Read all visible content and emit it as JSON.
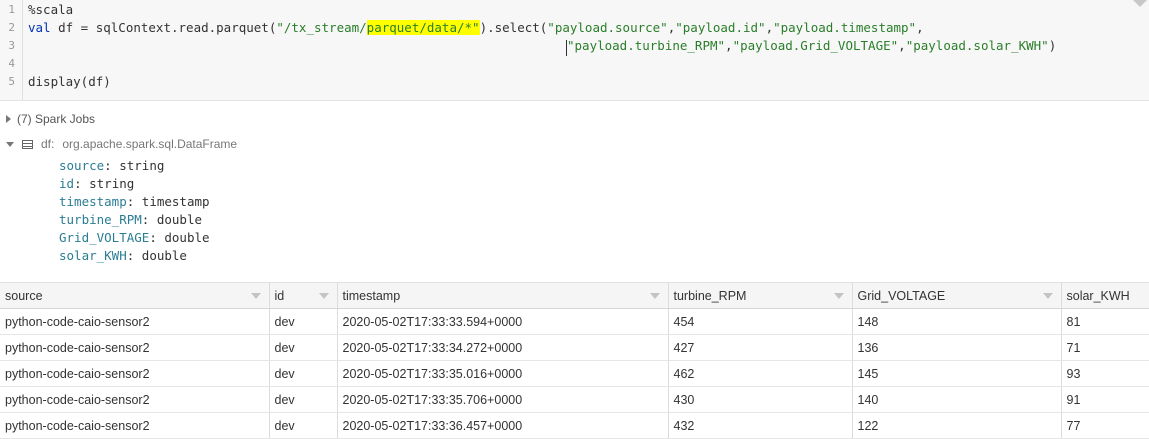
{
  "editor": {
    "line_numbers": [
      "1",
      "2",
      "3",
      "4",
      "5"
    ],
    "line1": "%scala",
    "line2": {
      "kw": "val",
      "pre": " df = sqlContext.read.parquet(",
      "str_a": "\"/tx_stream/",
      "str_hl": "parquet/data/*\"",
      "mid": ").select(",
      "s1": "\"payload.source\"",
      "s2": "\"payload.id\"",
      "s3": "\"payload.timestamp\"",
      "tail": ","
    },
    "line3": {
      "s4": "\"payload.turbine_RPM\"",
      "s5": "\"payload.Grid_VOLTAGE\"",
      "s6": "\"payload.solar_KWH\"",
      "tail": ")"
    },
    "line5": "display(df)"
  },
  "output": {
    "spark_jobs": "(7) Spark Jobs",
    "df_name": "df:",
    "df_type": "org.apache.spark.sql.DataFrame",
    "schema": [
      {
        "name": "source",
        "type": " string"
      },
      {
        "name": "id",
        "type": " string"
      },
      {
        "name": "timestamp",
        "type": " timestamp"
      },
      {
        "name": "turbine_RPM",
        "type": " double"
      },
      {
        "name": "Grid_VOLTAGE",
        "type": " double"
      },
      {
        "name": "solar_KWH",
        "type": " double"
      }
    ]
  },
  "table": {
    "columns": [
      "source",
      "id",
      "timestamp",
      "turbine_RPM",
      "Grid_VOLTAGE",
      "solar_KWH"
    ],
    "rows": [
      [
        "python-code-caio-sensor2",
        "dev",
        "2020-05-02T17:33:33.594+0000",
        "454",
        "148",
        "81"
      ],
      [
        "python-code-caio-sensor2",
        "dev",
        "2020-05-02T17:33:34.272+0000",
        "427",
        "136",
        "71"
      ],
      [
        "python-code-caio-sensor2",
        "dev",
        "2020-05-02T17:33:35.016+0000",
        "462",
        "145",
        "93"
      ],
      [
        "python-code-caio-sensor2",
        "dev",
        "2020-05-02T17:33:35.706+0000",
        "430",
        "140",
        "91"
      ],
      [
        "python-code-caio-sensor2",
        "dev",
        "2020-05-02T17:33:36.457+0000",
        "432",
        "122",
        "77"
      ]
    ]
  },
  "colors": {
    "highlight": "#ffff00",
    "keyword": "#0033b3",
    "string": "#2a7e2a",
    "schema_key": "#2a7e93"
  }
}
